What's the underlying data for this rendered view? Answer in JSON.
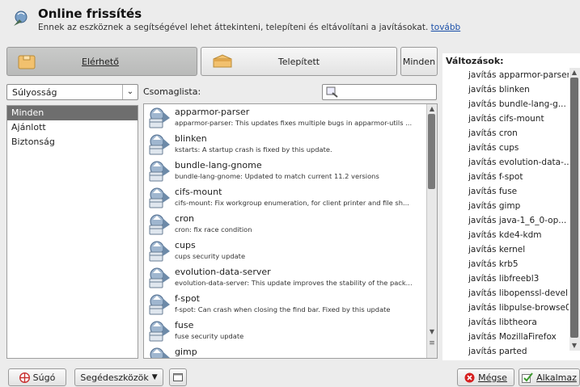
{
  "header": {
    "title": "Online frissítés",
    "subtitle": "Ennek az eszköznek a segítségével lehet áttekinteni, telepíteni és eltávolítani a javításokat.",
    "more_link": "tovább"
  },
  "tabs": {
    "available": "Elérhető",
    "installed": "Telepített",
    "all": "Minden"
  },
  "filter": {
    "combo_value": "Súlyosság",
    "items": [
      "Minden",
      "Ajánlott",
      "Biztonság"
    ],
    "selected": "Minden"
  },
  "package_list": {
    "label": "Csomaglista:",
    "search_value": "",
    "items": [
      {
        "name": "apparmor-parser",
        "desc": "apparmor-parser: This updates fixes multiple bugs in apparmor-utils ..."
      },
      {
        "name": "blinken",
        "desc": "kstarts: A startup crash is fixed by this update."
      },
      {
        "name": "bundle-lang-gnome",
        "desc": "bundle-lang-gnome: Updated to match current 11.2 versions"
      },
      {
        "name": "cifs-mount",
        "desc": "cifs-mount: Fix workgroup enumeration, for client printer and file sh..."
      },
      {
        "name": "cron",
        "desc": "cron: fix race condition"
      },
      {
        "name": "cups",
        "desc": "cups security update"
      },
      {
        "name": "evolution-data-server",
        "desc": "evolution-data-server: This update improves the stability of the pack..."
      },
      {
        "name": "f-spot",
        "desc": "f-spot: Can crash when closing the find bar. Fixed by this update"
      },
      {
        "name": "fuse",
        "desc": "fuse security update"
      },
      {
        "name": "gimp",
        "desc": ""
      }
    ]
  },
  "changes": {
    "title": "Változások:",
    "items": [
      "javítás apparmor-parser",
      "javítás blinken",
      "javítás bundle-lang-g...",
      "javítás cifs-mount",
      "javítás cron",
      "javítás cups",
      "javítás evolution-data-...",
      "javítás f-spot",
      "javítás fuse",
      "javítás gimp",
      "javítás java-1_6_0-op...",
      "javítás kde4-kdm",
      "javítás kernel",
      "javítás krb5",
      "javítás libfreebl3",
      "javítás libopenssl-devel",
      "javítás libpulse-browse0",
      "javítás libtheora",
      "javítás MozillaFirefox",
      "javítás parted"
    ]
  },
  "bottom": {
    "help": "Súgó",
    "tools": "Segédeszközök",
    "cancel": "Mégse",
    "apply": "Alkalmaz"
  },
  "colors": {
    "selection": "#6e6e6e",
    "link": "#1a4fa8",
    "cancel_icon": "#d62020",
    "apply_icon": "#3c9a2e"
  },
  "icons": [
    "update-app-icon",
    "package-box-icon",
    "search-icon",
    "update-package-icon",
    "help-icon",
    "chevron-down-icon",
    "terminal-icon",
    "cancel-icon",
    "check-icon"
  ]
}
